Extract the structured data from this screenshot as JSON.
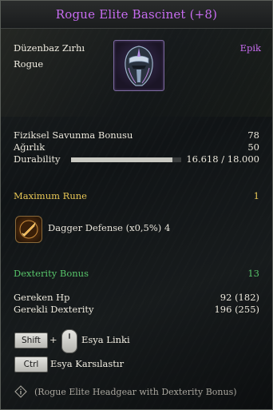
{
  "tooltip": {
    "title": "Rogue Elite Bascinet (+8)",
    "item_name": "Düzenbaz Zırhı",
    "class_name": "Rogue",
    "rarity": "Epik",
    "stats": [
      {
        "label": "Fiziksel Savunma Bonusu",
        "value": "78"
      },
      {
        "label": "Ağırlık",
        "value": "50"
      }
    ],
    "durability": {
      "label": "Durability",
      "value": "16.618 / 18.000",
      "current": 16618,
      "max": 18000
    },
    "rune_section": {
      "label": "Maximum Rune",
      "count": "1"
    },
    "rune": {
      "text": "Dagger Defense (x0,5%) 4",
      "icon": "dagger-rune-icon"
    },
    "bonus_section": {
      "label": "Dexterity Bonus",
      "value": "13"
    },
    "requirements": [
      {
        "label": "Gereken Hp",
        "value": "92 (182)"
      },
      {
        "label": "Gerekli  Dexterity",
        "value": "196 (255)"
      }
    ],
    "hints": {
      "shift_key": "Shift",
      "plus": "+",
      "link_label": "Esya Linki",
      "ctrl_key": "Ctrl",
      "compare_label": "Esya Karsılastır"
    },
    "footer": "(Rogue Elite Headgear with Dexterity Bonus)",
    "colors": {
      "epic": "#c76cf0",
      "gold": "#e6c555",
      "green": "#57c46a"
    }
  }
}
